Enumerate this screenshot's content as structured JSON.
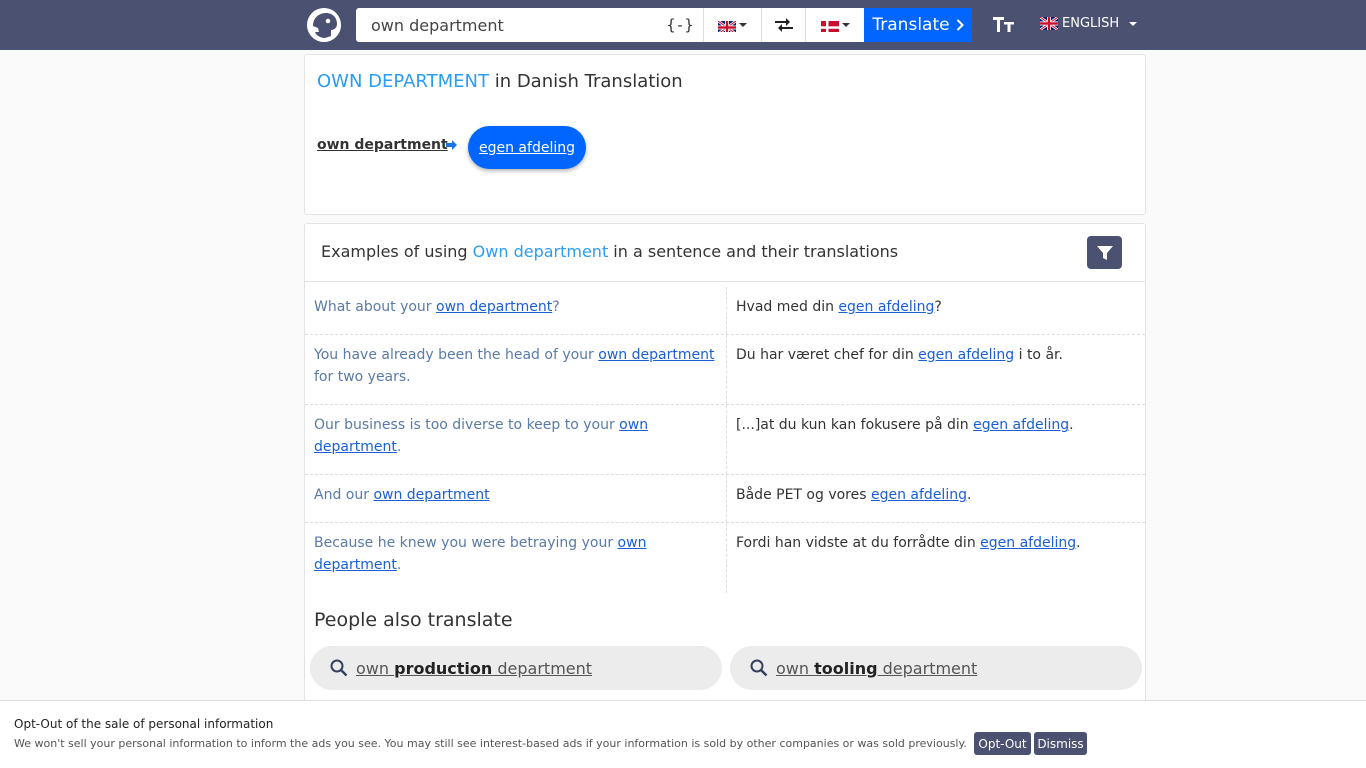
{
  "header": {
    "search_value": "own department",
    "brace_label": "{-}",
    "translate_label": "Translate",
    "text_size_label": "TT",
    "interface_language": "ENGLISH"
  },
  "colors": {
    "accent": "#2a9df4",
    "brand": "#4b5170",
    "button": "#0066ff"
  },
  "icons": [
    "logo-icon",
    "uk-flag-icon",
    "swap-icon",
    "denmark-flag-icon",
    "chevron-right-icon",
    "text-size-icon",
    "filter-icon",
    "search-icon"
  ],
  "translation": {
    "title_term": "OWN DEPARTMENT",
    "title_rest": " in Danish Translation",
    "source": "own department",
    "target": "egen afdeling"
  },
  "examples": {
    "head_pre": "Examples of using ",
    "head_term": "Own department",
    "head_post": " in a sentence and their translations",
    "rows": [
      {
        "src_pre": "What about your ",
        "src_link": "own department",
        "src_post": "?",
        "tgt_pre": "Hvad med din ",
        "tgt_link": "egen afdeling",
        "tgt_post": "?"
      },
      {
        "src_pre": "You have already been the head of your ",
        "src_link": "own department",
        "src_post": " for two years.",
        "tgt_pre": "Du har været chef for din ",
        "tgt_link": "egen afdeling",
        "tgt_post": " i to år."
      },
      {
        "src_pre": "Our business is too diverse to keep to your ",
        "src_link": "own department",
        "src_post": ".",
        "tgt_pre": "[...]at du kun kan fokusere på din ",
        "tgt_link": "egen afdeling",
        "tgt_post": "."
      },
      {
        "src_pre": "And our ",
        "src_link": "own department",
        "src_post": "",
        "tgt_pre": "Både PET og vores ",
        "tgt_link": "egen afdeling",
        "tgt_post": "."
      },
      {
        "src_pre": "Because he knew you were betraying your ",
        "src_link": "own department",
        "src_post": ".",
        "tgt_pre": "Fordi han vidste at du forrådte din ",
        "tgt_link": "egen afdeling",
        "tgt_post": "."
      }
    ]
  },
  "related": {
    "title": "People also translate",
    "items": [
      {
        "pre": "own ",
        "bold": "production",
        "post": " department"
      },
      {
        "pre": "own ",
        "bold": "tooling",
        "post": " department"
      }
    ]
  },
  "consent": {
    "title": "Opt-Out of the sale of personal information",
    "text": "We won't sell your personal information to inform the ads you see. You may still see interest-based ads if your information is sold by other companies or was sold previously.",
    "optout_label": "Opt-Out",
    "dismiss_label": "Dismiss"
  }
}
